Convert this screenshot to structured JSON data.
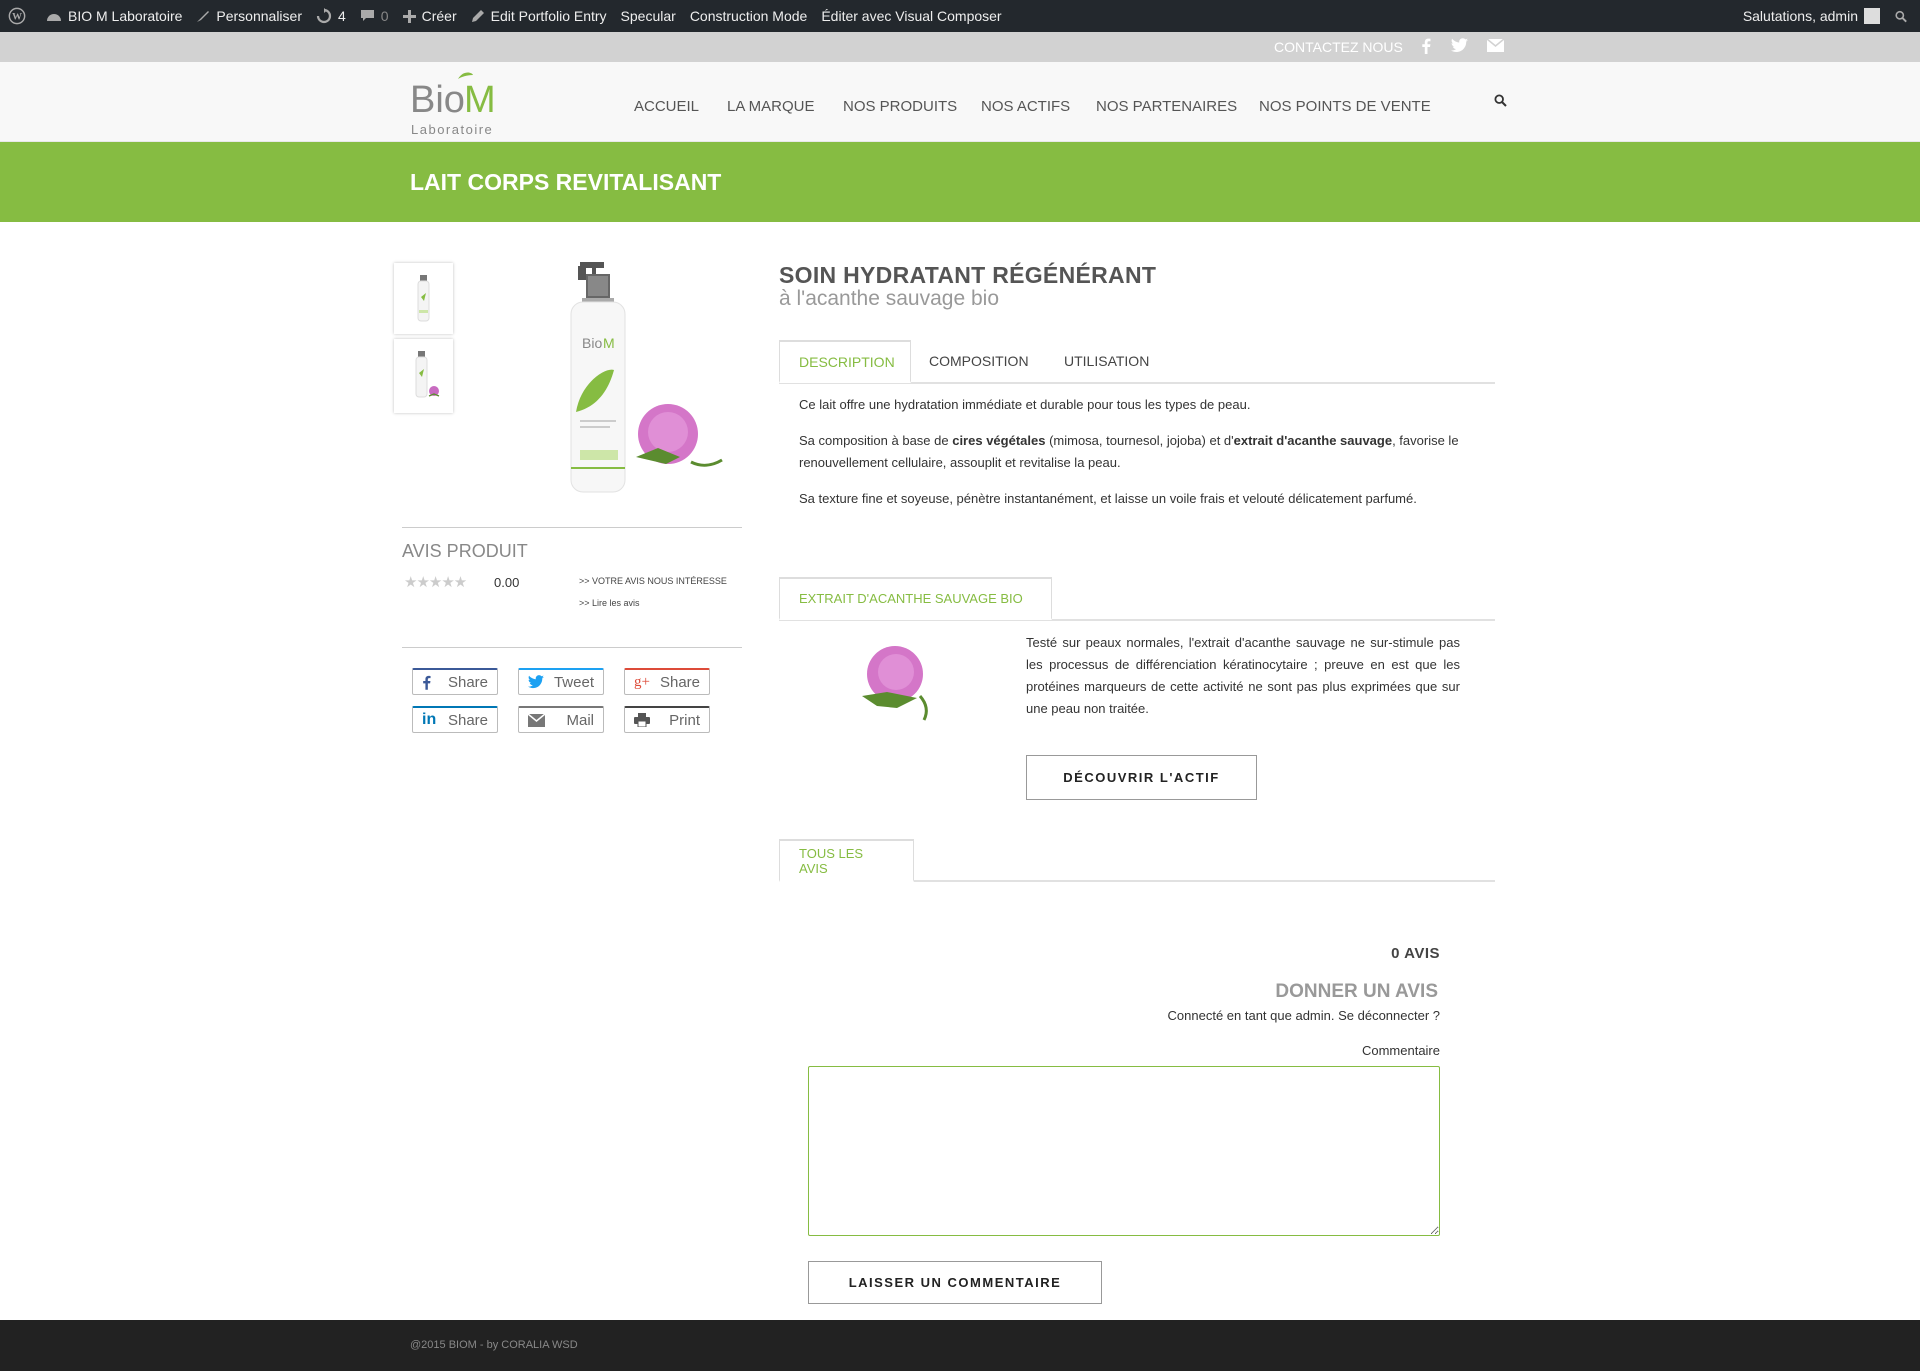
{
  "adminbar": {
    "site_name": "BIO M Laboratoire",
    "customize": "Personnaliser",
    "updates_count": "4",
    "comments_count": "0",
    "create": "Créer",
    "edit_entry": "Edit Portfolio Entry",
    "specular": "Specular",
    "construction": "Construction Mode",
    "visual_composer": "Éditer avec Visual Composer",
    "greeting": "Salutations, admin"
  },
  "topbar": {
    "contact": "CONTACTEZ NOUS"
  },
  "nav": {
    "items": [
      "ACCUEIL",
      "LA MARQUE",
      "NOS PRODUITS",
      "NOS ACTIFS",
      "NOS PARTENAIRES",
      "NOS POINTS DE VENTE"
    ]
  },
  "logo": {
    "brand": "BioM",
    "sub": "Laboratoire"
  },
  "page_title": "LAIT CORPS REVITALISANT",
  "product": {
    "heading": "SOIN HYDRATANT RÉGÉNÉRANT",
    "subheading": "à l'acanthe sauvage bio",
    "tabs": [
      "DESCRIPTION",
      "COMPOSITION",
      "UTILISATION"
    ],
    "desc_p1": "Ce lait  offre une hydratation immédiate et durable pour tous les types de peau.",
    "desc_p2_a": "Sa composition à base de ",
    "desc_p2_b": "cires végétales",
    "desc_p2_c": " (mimosa, tournesol, jojoba) et d'",
    "desc_p2_d": "extrait d'acanthe sauvage",
    "desc_p2_e": ", favorise le renouvellement cellulaire, assouplit et revitalise la peau.",
    "desc_p3": "Sa texture fine et soyeuse, pénètre instantanément, et laisse un voile frais et velouté délicatement parfumé."
  },
  "extrait": {
    "tab": "EXTRAIT D'ACANTHE SAUVAGE BIO",
    "text": "Testé sur peaux normales, l'extrait d'acanthe sauvage ne sur-stimule pas les processus de différenciation kératinocytaire ; preuve en est que les protéines marqueurs de cette activité ne sont pas plus exprimées que sur une peau non traitée.",
    "button": "DÉCOUVRIR L'ACTIF"
  },
  "avis_produit": {
    "title": "AVIS PRODUIT",
    "rating": "0.00",
    "link1": ">> VOTRE AVIS NOUS INTÉRESSE",
    "link2": ">> Lire les avis"
  },
  "share": {
    "facebook": "Share",
    "twitter": "Tweet",
    "google": "Share",
    "linkedin": "Share",
    "mail": "Mail",
    "print": "Print"
  },
  "reviews": {
    "tab": "TOUS LES AVIS",
    "count": "0 AVIS",
    "give": "DONNER UN AVIS",
    "logged_in": "Connecté en tant que admin. Se déconnecter ?",
    "comment_label": "Commentaire",
    "submit": "LAISSER UN COMMENTAIRE"
  },
  "footer": {
    "text": "@2015 BIOM - by CORALIA WSD"
  },
  "colors": {
    "brand_green": "#86bc42",
    "adminbar": "#23282d",
    "topbar": "#d2d2d2",
    "footer": "#222222"
  }
}
